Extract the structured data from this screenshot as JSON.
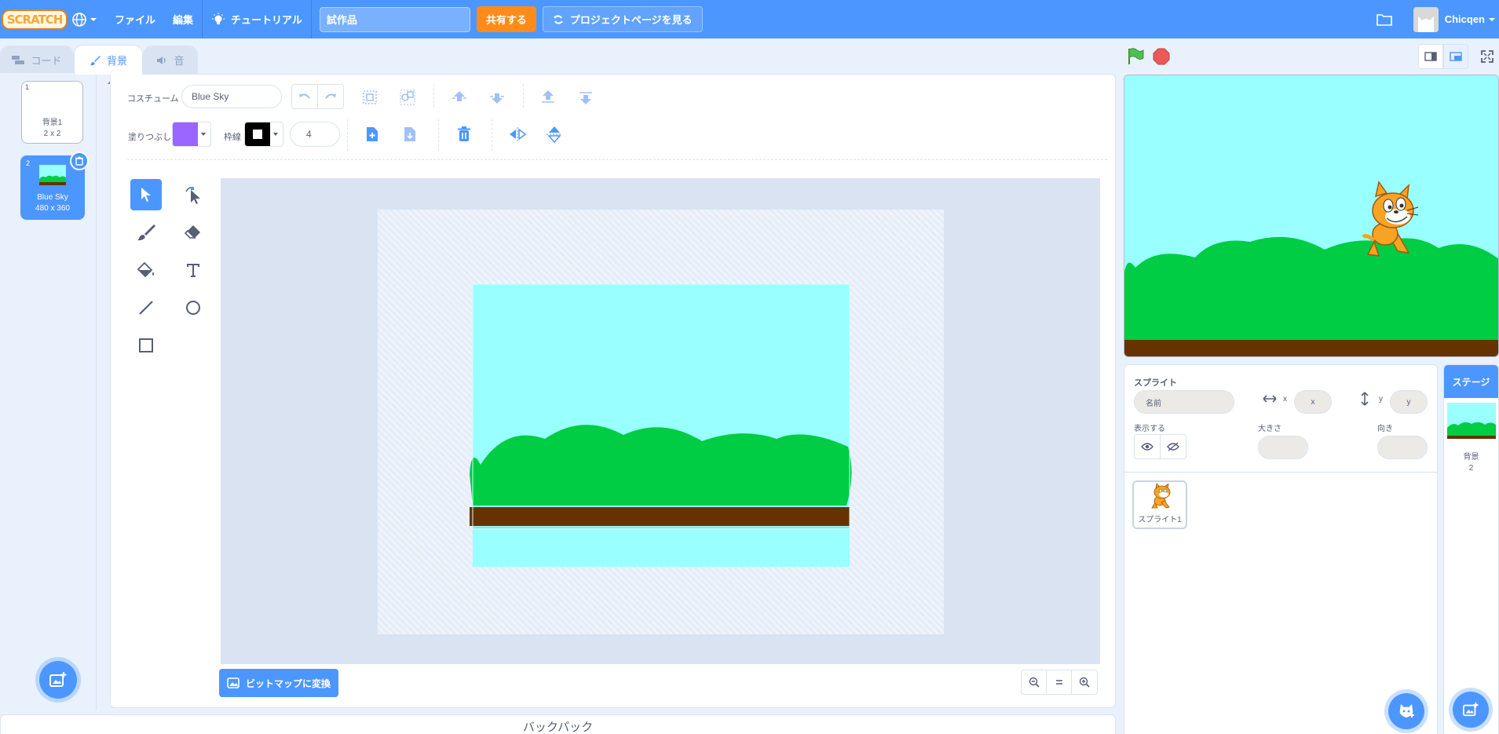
{
  "menubar": {
    "logo": "SCRATCH",
    "file": "ファイル",
    "edit": "編集",
    "tutorials": "チュートリアル",
    "project_title": "試作品",
    "share": "共有する",
    "see_project_page": "プロジェクトページを見る",
    "username": "Chicqen"
  },
  "tabs": [
    {
      "label": "コード",
      "icon": "code-icon"
    },
    {
      "label": "背景",
      "icon": "brush-icon"
    },
    {
      "label": "音",
      "icon": "speaker-icon"
    }
  ],
  "costumes": [
    {
      "number": "1",
      "name": "背景1",
      "size": "2 x 2"
    },
    {
      "number": "2",
      "name": "Blue Sky",
      "size": "480 x 360"
    }
  ],
  "editor": {
    "costume_label": "コスチューム",
    "costume_name": "Blue Sky",
    "fill_label": "塗りつぶし",
    "outline_label": "枠線",
    "outline_width": "4",
    "fill_color": "#9966ff",
    "outline_color": "#000000",
    "convert_button": "ビットマップに変換"
  },
  "backpack": "バックパック",
  "sprite_info": {
    "sprite_label": "スプライト",
    "name_placeholder": "名前",
    "x_label": "x",
    "y_label": "y",
    "x_placeholder": "x",
    "y_placeholder": "y",
    "show_label": "表示する",
    "size_label": "大きさ",
    "direction_label": "向き"
  },
  "sprites": [
    {
      "name": "スプライト1"
    }
  ],
  "stage_pane": {
    "tab": "ステージ",
    "backdrops_label": "背景",
    "backdrops_count": "2"
  },
  "colors": {
    "accent": "#4c97ff",
    "share": "#ff8c1a",
    "sky": "#99ffff",
    "grass": "#00cc44",
    "ground": "#663300"
  }
}
